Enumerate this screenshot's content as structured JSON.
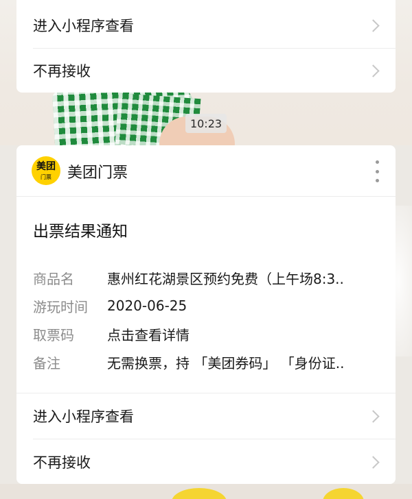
{
  "top_card": {
    "open_miniprogram_label": "进入小程序查看",
    "unsubscribe_label": "不再接收"
  },
  "timestamp": "10:23",
  "message": {
    "account": {
      "logo_text": "美团",
      "logo_subtext": "门票",
      "name": "美团门票"
    },
    "title": "出票结果通知",
    "fields": [
      {
        "key": "商品名",
        "value": "惠州红花湖景区预约免费（上午场8:3.."
      },
      {
        "key": "游玩时间",
        "value": "2020-06-25"
      },
      {
        "key": "取票码",
        "value": "点击查看详情"
      },
      {
        "key": "备注",
        "value": "无需换票，持 「美团券码」 「身份证.."
      }
    ],
    "open_miniprogram_label": "进入小程序查看",
    "unsubscribe_label": "不再接收"
  },
  "icons": {
    "chevron": "chevron-right-icon",
    "more": "more-vertical-icon"
  },
  "colors": {
    "brand_yellow": "#ffd100",
    "card_bg": "#ffffff",
    "label_gray": "#8c8c8c"
  }
}
